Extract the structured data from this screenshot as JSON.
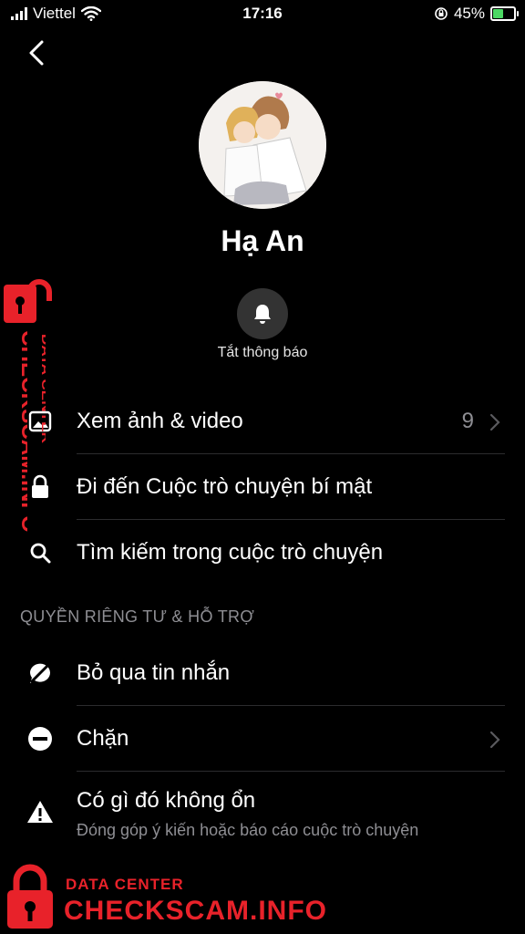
{
  "status_bar": {
    "carrier": "Viettel",
    "time": "17:16",
    "battery": "45%",
    "battery_level": 0.45
  },
  "profile": {
    "name": "Hạ An",
    "mute_label": "Tắt thông báo"
  },
  "menu": {
    "media": {
      "label": "Xem ảnh & video",
      "count": "9"
    },
    "secret": {
      "label": "Đi đến Cuộc trò chuyện bí mật"
    },
    "search": {
      "label": "Tìm kiếm trong cuộc trò chuyện"
    }
  },
  "privacy_section": {
    "header": "QUYỀN RIÊNG TƯ & HỖ TRỢ",
    "ignore": {
      "label": "Bỏ qua tin nhắn"
    },
    "block": {
      "label": "Chặn"
    },
    "report": {
      "label": "Có gì đó không ổn",
      "sub": "Đóng góp ý kiến hoặc báo cáo cuộc trò chuyện"
    }
  },
  "watermark": {
    "small": "DATA CENTER",
    "big": "CHECKSCAM.INFO"
  },
  "colors": {
    "background": "#000000",
    "watermark_red": "#e8222a",
    "secondary_text": "#8e8e93",
    "divider": "#2c2c2e"
  }
}
